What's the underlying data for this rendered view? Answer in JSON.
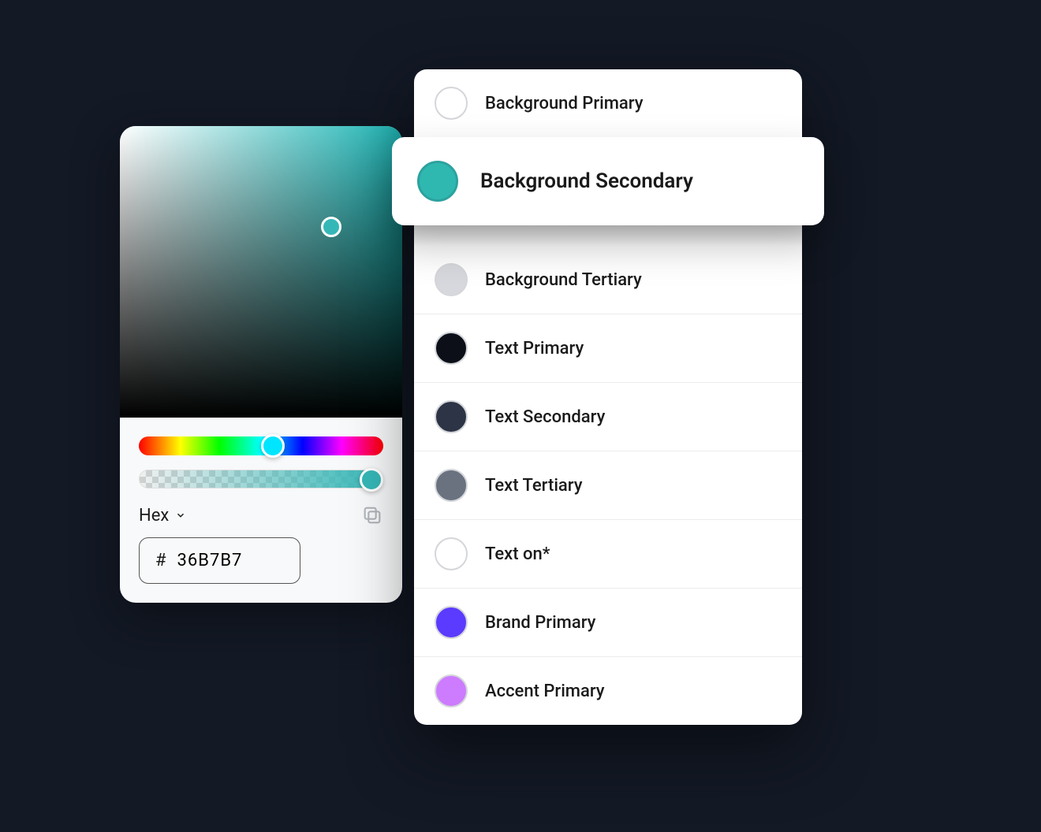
{
  "picker": {
    "selected_color": "#36B7B7",
    "format_label": "Hex",
    "hex_prefix": "#",
    "hex_value": "36B7B7",
    "hue_position_pct": 50,
    "alpha_position_pct": 100
  },
  "tokens": [
    {
      "label": "Background Primary",
      "swatch": "#ffffff",
      "selected": false
    },
    {
      "label": "Background Secondary",
      "swatch": "#2eb8b0",
      "selected": true
    },
    {
      "label": "Background Tertiary",
      "swatch": "#d7d8dd",
      "selected": false
    },
    {
      "label": "Text Primary",
      "swatch": "#0c0f18",
      "selected": false
    },
    {
      "label": "Text Secondary",
      "swatch": "#2c3445",
      "selected": false
    },
    {
      "label": "Text Tertiary",
      "swatch": "#6a7280",
      "selected": false
    },
    {
      "label": "Text on*",
      "swatch": "#ffffff",
      "selected": false
    },
    {
      "label": "Brand Primary",
      "swatch": "#5a3bff",
      "selected": false
    },
    {
      "label": "Accent Primary",
      "swatch": "#cd7bff",
      "selected": false
    }
  ]
}
